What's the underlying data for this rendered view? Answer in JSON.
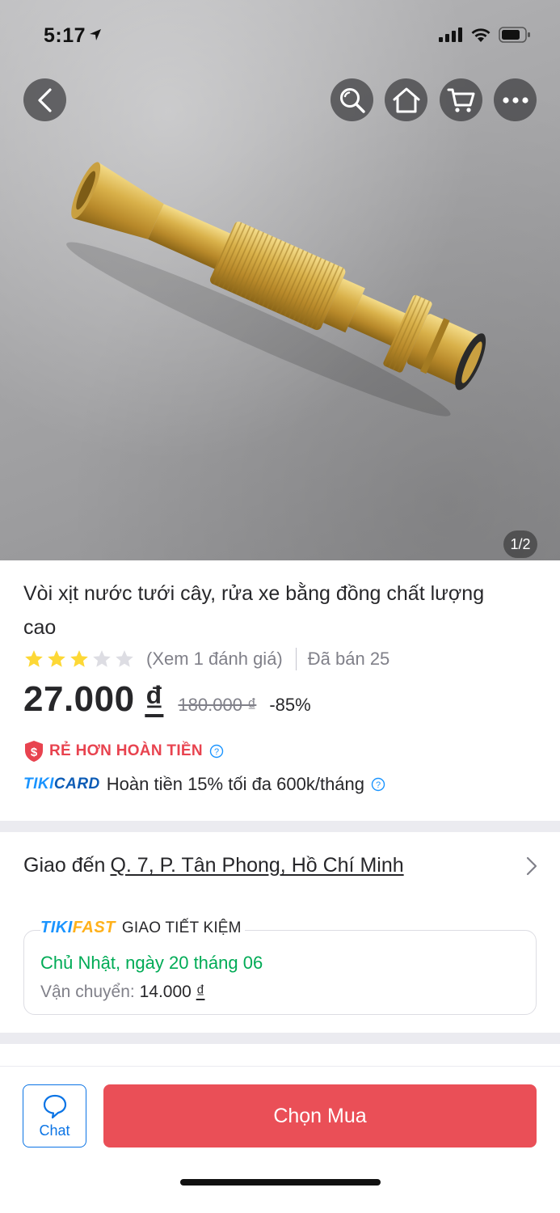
{
  "status_bar": {
    "time": "5:17"
  },
  "hero": {
    "image_counter": "1/2",
    "image_alt": "brass hose spray nozzle"
  },
  "product": {
    "title": "Vòi xịt nước tưới cây, rửa xe bằng đồng chất lượng cao",
    "rating": 3,
    "rating_max": 5,
    "review_link": "(Xem 1 đánh giá)",
    "sold": "Đã bán 25",
    "price": "27.000",
    "price_currency": "₫",
    "original_price": "180.000 ₫",
    "discount": "-85%",
    "refund_label": "RẺ HƠN HOÀN TIỀN",
    "tikicard_logo_a": "TIKI",
    "tikicard_logo_b": "CARD",
    "tikicard_text": "Hoàn tiền 15% tối đa 600k/tháng"
  },
  "delivery": {
    "label": "Giao đến",
    "address": "Q. 7, P. Tân Phong, Hồ Chí Minh",
    "badge_logo_a": "TIKI",
    "badge_logo_b": "FAST",
    "shipping_type": "GIAO TIẾT KIỆM",
    "date": "Chủ Nhật, ngày 20 tháng 06",
    "fee_label": "Vận chuyển:",
    "fee_value": "14.000",
    "fee_currency": "₫"
  },
  "bottom_bar": {
    "chat_label": "Chat",
    "buy_label": "Chọn Mua"
  },
  "colors": {
    "accent_red": "#ea4f57",
    "tiki_blue": "#1a94ff",
    "delivery_green": "#00ab56",
    "star_yellow": "#fdd836"
  }
}
